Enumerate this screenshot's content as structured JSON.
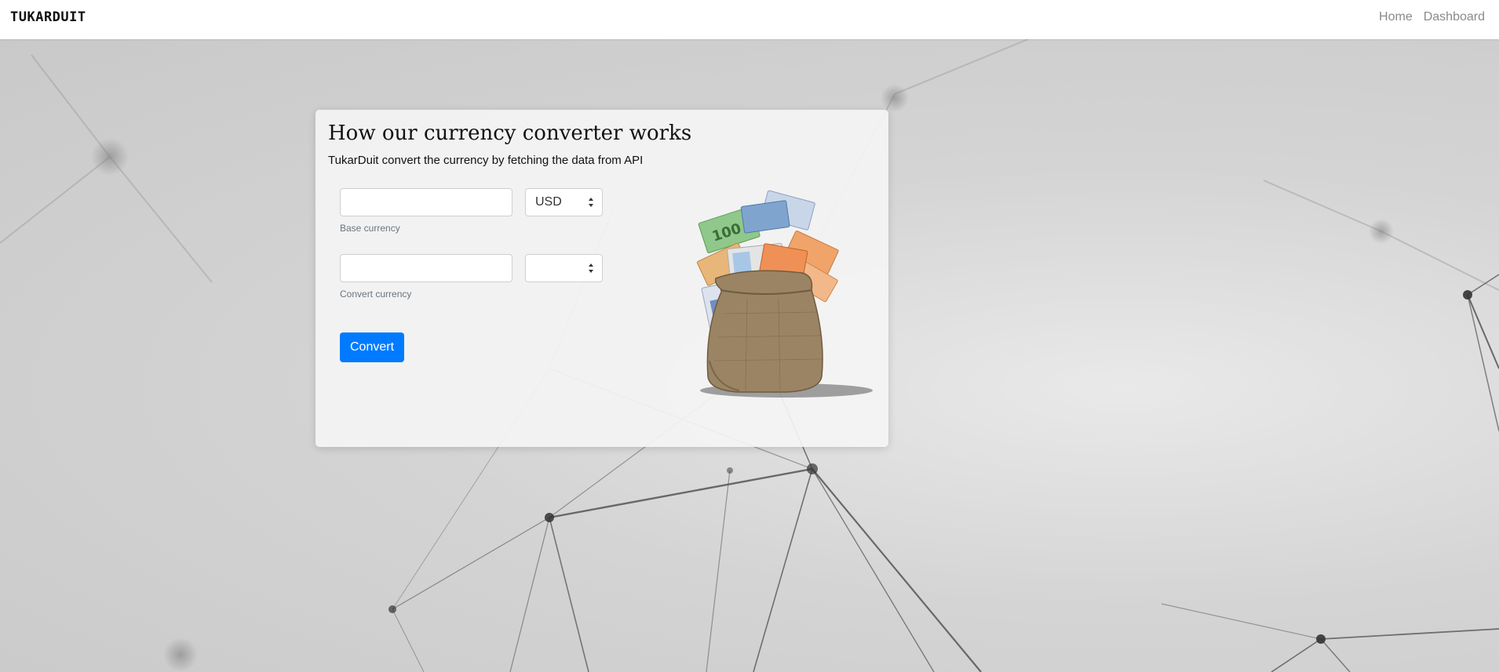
{
  "navbar": {
    "brand": "TUKARDUIT",
    "links": [
      "Home",
      "Dashboard"
    ]
  },
  "card": {
    "title": "How our currency converter works",
    "subtitle": "TukarDuit convert the currency by fetching the data from API"
  },
  "form": {
    "base": {
      "value": "",
      "currency": "USD",
      "helper": "Base currency"
    },
    "convert": {
      "value": "",
      "currency": "",
      "helper": "Convert currency"
    },
    "button_label": "Convert"
  },
  "colors": {
    "primary": "#007bff",
    "nav_link": "#8a8a8a",
    "helper_text": "#6c757d"
  },
  "icons": {
    "illustration": "money-bag-illustration",
    "select_arrows": "updown-arrows-icon"
  }
}
